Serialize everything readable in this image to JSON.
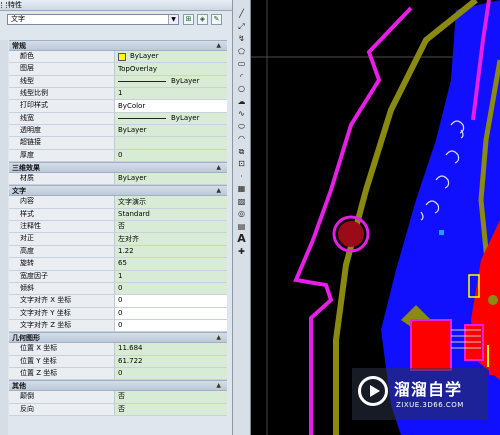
{
  "panel": {
    "title": "特性",
    "selected_object": "文字",
    "toolbar_buttons": [
      "toggle-pickadd-icon",
      "select-objects-icon",
      "quick-select-icon"
    ]
  },
  "sections": [
    {
      "title": "常规",
      "rows": [
        {
          "k": "颜色",
          "v": "ByLayer",
          "type": "color",
          "color": "#ffff00"
        },
        {
          "k": "图层",
          "v": "TopOverlay"
        },
        {
          "k": "线型",
          "v": "ByLayer",
          "type": "line"
        },
        {
          "k": "线型比例",
          "v": "1"
        },
        {
          "k": "打印样式",
          "v": "ByColor",
          "white": true
        },
        {
          "k": "线宽",
          "v": "ByLayer",
          "type": "line"
        },
        {
          "k": "透明度",
          "v": "ByLayer"
        },
        {
          "k": "超链接",
          "v": ""
        },
        {
          "k": "厚度",
          "v": "0"
        }
      ]
    },
    {
      "title": "三维效果",
      "rows": [
        {
          "k": "材质",
          "v": "ByLayer"
        }
      ]
    },
    {
      "title": "文字",
      "rows": [
        {
          "k": "内容",
          "v": "文字演示"
        },
        {
          "k": "样式",
          "v": "Standard"
        },
        {
          "k": "注释性",
          "v": "否"
        },
        {
          "k": "对正",
          "v": "左对齐"
        },
        {
          "k": "高度",
          "v": "1.22"
        },
        {
          "k": "旋转",
          "v": "65"
        },
        {
          "k": "宽度因子",
          "v": "1"
        },
        {
          "k": "倾斜",
          "v": "0"
        },
        {
          "k": "文字对齐 X 坐标",
          "v": "0",
          "white": true
        },
        {
          "k": "文字对齐 Y 坐标",
          "v": "0",
          "white": true
        },
        {
          "k": "文字对齐 Z 坐标",
          "v": "0",
          "white": true
        }
      ]
    },
    {
      "title": "几何图形",
      "rows": [
        {
          "k": "位置 X 坐标",
          "v": "11.684"
        },
        {
          "k": "位置 Y 坐标",
          "v": "61.722"
        },
        {
          "k": "位置 Z 坐标",
          "v": "0"
        }
      ]
    },
    {
      "title": "其他",
      "rows": [
        {
          "k": "颠倒",
          "v": "否"
        },
        {
          "k": "反向",
          "v": "否"
        }
      ]
    }
  ],
  "draw_tools": [
    "line-icon",
    "construction-line-icon",
    "polyline-icon",
    "polygon-icon",
    "rectangle-icon",
    "arc-icon",
    "circle-icon",
    "revision-cloud-icon",
    "spline-icon",
    "ellipse-icon",
    "ellipse-arc-icon",
    "insert-block-icon",
    "make-block-icon",
    "point-icon",
    "hatch-icon",
    "gradient-icon",
    "region-icon",
    "table-icon",
    "multiline-text-icon",
    "add-selected-icon"
  ],
  "watermark": {
    "name": "溜溜自学",
    "url": "ZIXUE.3D66.COM"
  },
  "colors": {
    "magenta": "#e61ee6",
    "olive": "#8a8a10",
    "blue": "#1010ff",
    "red": "#ff0000",
    "dark_red": "#9a0a18",
    "yellow": "#ffff00"
  }
}
